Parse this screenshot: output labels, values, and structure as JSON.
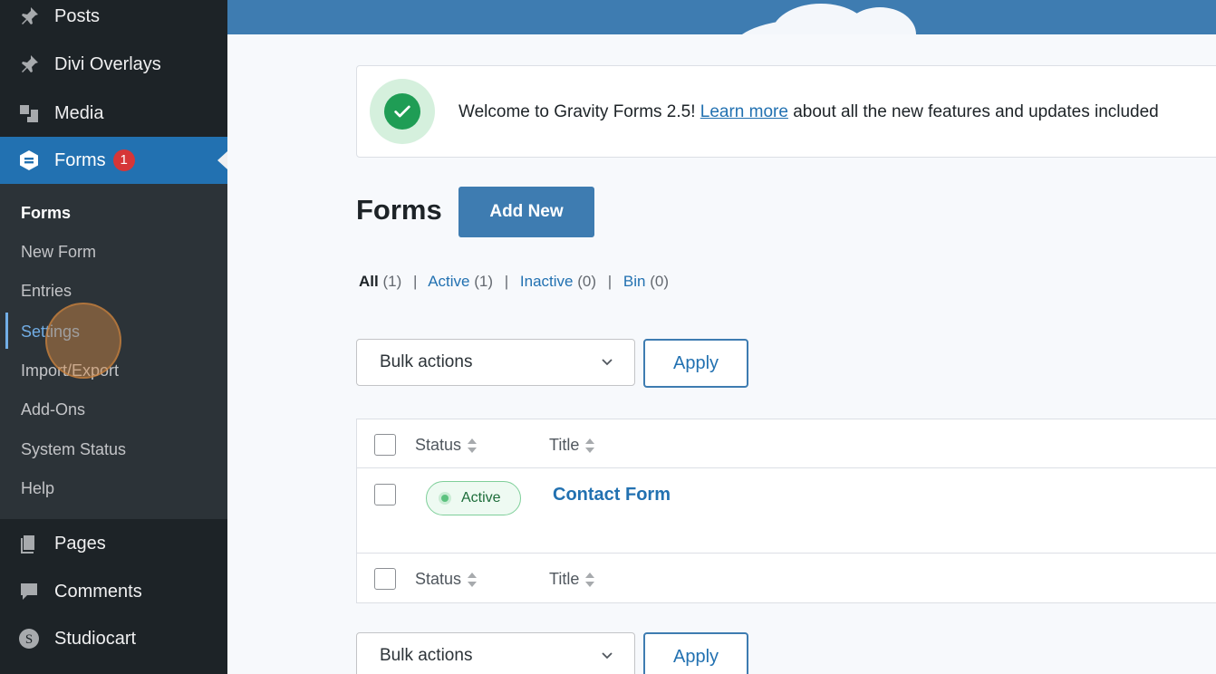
{
  "sidebar": {
    "top_items": [
      {
        "label": "Posts",
        "icon": "pin-icon"
      },
      {
        "label": "Divi Overlays",
        "icon": "pin-icon"
      },
      {
        "label": "Media",
        "icon": "media-icon"
      },
      {
        "label": "Forms",
        "icon": "gravity-forms-icon",
        "badge": "1"
      }
    ],
    "submenu": [
      "Forms",
      "New Form",
      "Entries",
      "Settings",
      "Import/Export",
      "Add-Ons",
      "System Status",
      "Help"
    ],
    "bottom_items": [
      {
        "label": "Pages",
        "icon": "pages-icon"
      },
      {
        "label": "Comments",
        "icon": "comments-icon"
      },
      {
        "label": "Studiocart",
        "icon": "studiocart-icon",
        "glyph": "S"
      }
    ]
  },
  "notice": {
    "prefix": "Welcome to Gravity Forms 2.5! ",
    "link": "Learn more",
    "suffix": " about all the new features and updates included"
  },
  "page": {
    "title": "Forms",
    "add_new": "Add New"
  },
  "filters": [
    {
      "label": "All",
      "count": "(1)"
    },
    {
      "label": "Active",
      "count": "(1)"
    },
    {
      "label": "Inactive",
      "count": "(0)"
    },
    {
      "label": "Bin",
      "count": "(0)"
    }
  ],
  "bulk": {
    "label": "Bulk actions",
    "apply": "Apply"
  },
  "table": {
    "columns": [
      "Status",
      "Title"
    ],
    "rows": [
      {
        "status": "Active",
        "title": "Contact Form"
      }
    ]
  },
  "colors": {
    "sidebar": "#1d2327",
    "accent": "#2271b1",
    "button": "#3e7cb1",
    "badge": "#d63638",
    "success": "#1f9d55"
  }
}
